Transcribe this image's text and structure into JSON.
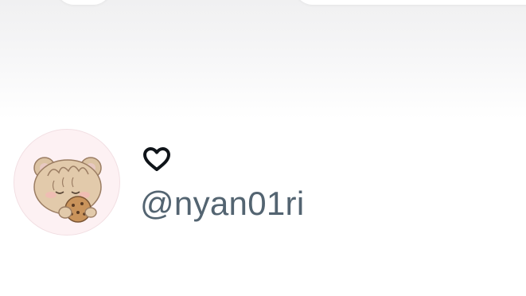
{
  "profile": {
    "display_name_icon": "heart-outline-icon",
    "handle": "@nyan01ri",
    "avatar_icon": "bear-eating-cookie-avatar"
  },
  "colors": {
    "handle_text": "#536471",
    "avatar_background": "#fdf1f3",
    "heart_stroke": "#0f1419"
  }
}
